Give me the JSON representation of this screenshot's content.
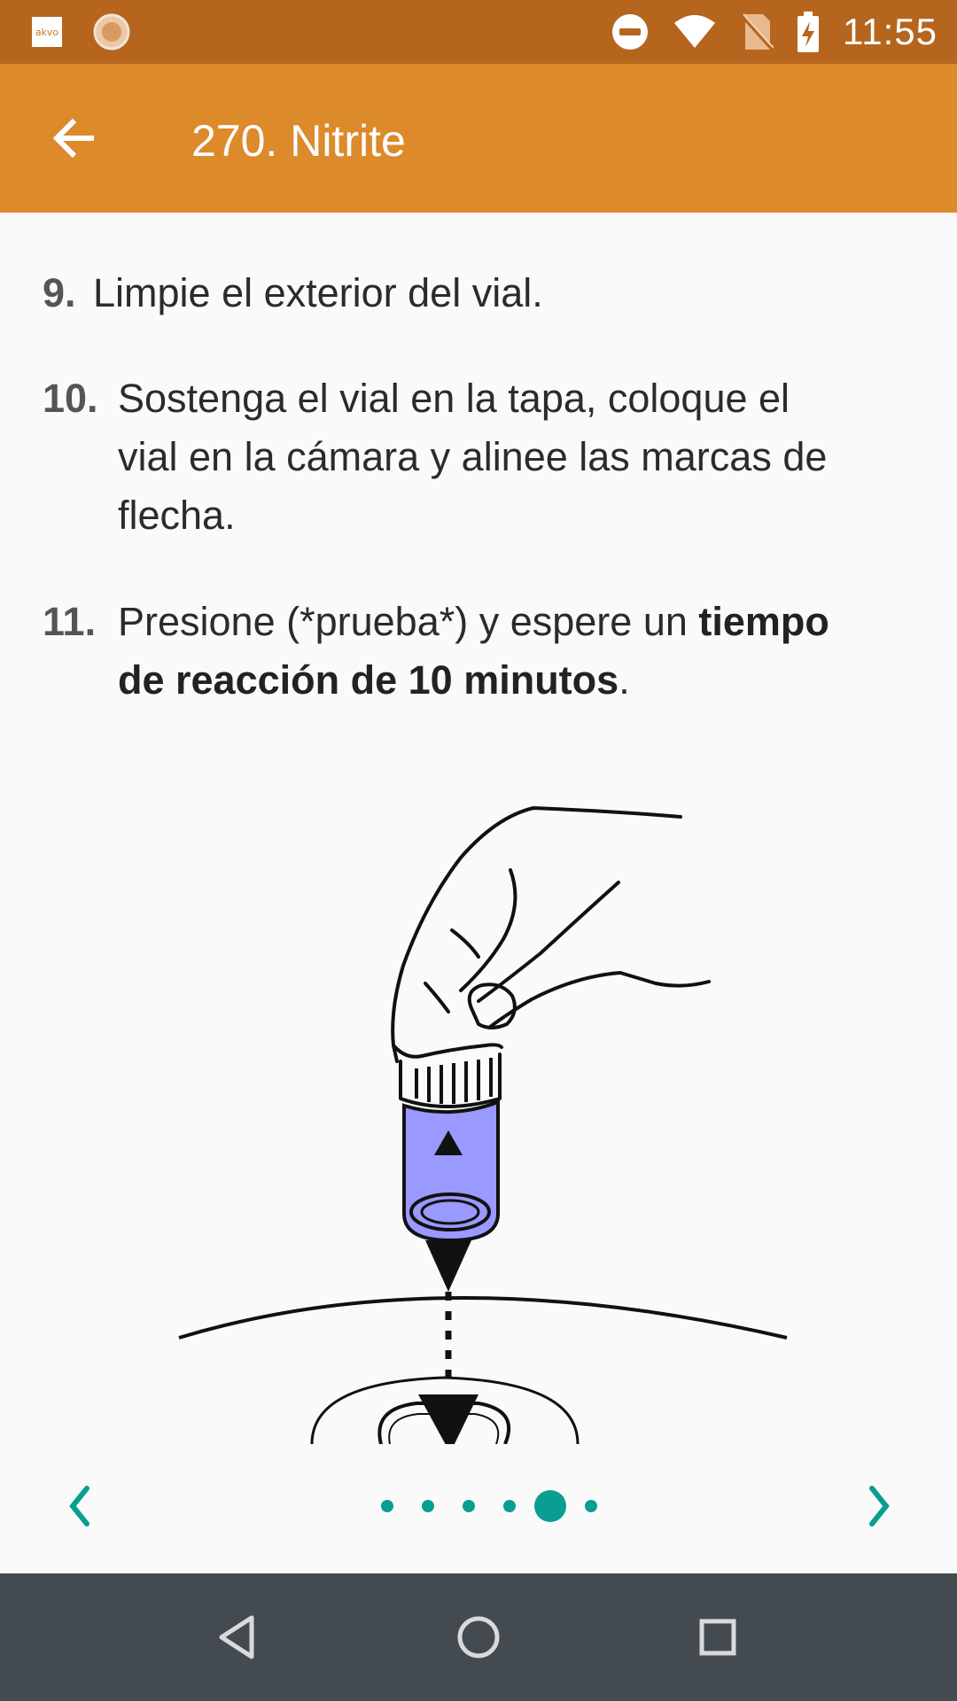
{
  "status_bar": {
    "time": "11:55",
    "app_badge_text": "akvo",
    "icons": [
      "akvo-app-icon",
      "sun-app-icon",
      "do-not-disturb-icon",
      "wifi-icon",
      "no-sim-icon",
      "battery-charging-icon"
    ]
  },
  "app_bar": {
    "title": "270. Nitrite",
    "back_icon": "arrow-back-icon"
  },
  "instructions": [
    {
      "number": "9.",
      "text": "Limpie el exterior del vial."
    },
    {
      "number": "10.",
      "lines": [
        "Sostenga el vial en la tapa, coloque el",
        "vial en la cámara y alinee las marcas de",
        "flecha."
      ]
    },
    {
      "number": "11.",
      "line1_normal": "Presione (*prueba*) y espere un ",
      "line1_bold": "tiempo",
      "line2_bold": "de reacción de 10 minutos",
      "line2_end": "."
    }
  ],
  "illustration": {
    "subject": "hand-holding-vial-over-camera",
    "vial_color": "#9999ff"
  },
  "pager": {
    "total_pages": 6,
    "current_page": 5,
    "accent_color": "#0a9e92",
    "prev_icon": "chevron-left-icon",
    "next_icon": "chevron-right-icon"
  },
  "nav_bar": {
    "icons": [
      "nav-back-icon",
      "nav-home-icon",
      "nav-recents-icon"
    ]
  },
  "colors": {
    "status_bar": "#b5651d",
    "app_bar": "#dd8a2b",
    "background": "#fafafa",
    "nav_bar": "#434a50"
  }
}
